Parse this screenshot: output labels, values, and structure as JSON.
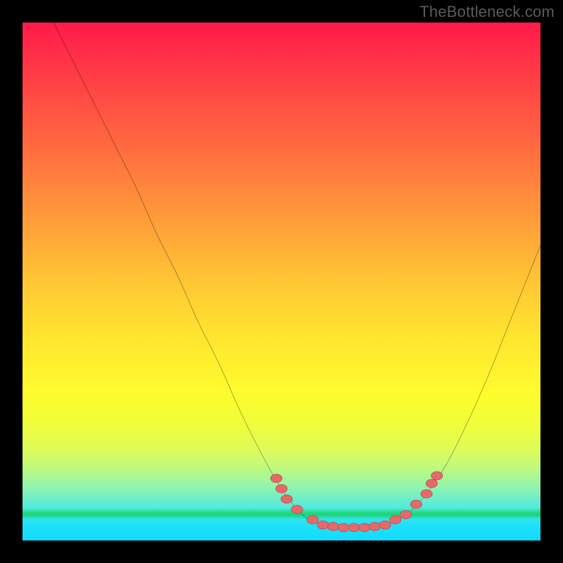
{
  "attribution": "TheBottleneck.com",
  "colors": {
    "background": "#000000",
    "attribution_text": "#5b5b5b",
    "curve_stroke": "#000000",
    "marker_fill": "#e46a6a",
    "marker_stroke": "#c74e4e",
    "gradient_top": "#ff1a4a",
    "gradient_bottom": "#10dcff",
    "green_band": "#1fd66f"
  },
  "chart_data": {
    "type": "line",
    "title": "",
    "xlabel": "",
    "ylabel": "",
    "xlim": [
      0,
      100
    ],
    "ylim": [
      0,
      100
    ],
    "grid": false,
    "legend": false,
    "curve": [
      {
        "x": 6,
        "y": 100
      },
      {
        "x": 10,
        "y": 92
      },
      {
        "x": 14,
        "y": 84
      },
      {
        "x": 18,
        "y": 76
      },
      {
        "x": 22,
        "y": 68
      },
      {
        "x": 26,
        "y": 59
      },
      {
        "x": 30,
        "y": 51
      },
      {
        "x": 34,
        "y": 42
      },
      {
        "x": 38,
        "y": 34
      },
      {
        "x": 42,
        "y": 25
      },
      {
        "x": 46,
        "y": 17
      },
      {
        "x": 50,
        "y": 10
      },
      {
        "x": 54,
        "y": 5
      },
      {
        "x": 58,
        "y": 3
      },
      {
        "x": 62,
        "y": 2.5
      },
      {
        "x": 66,
        "y": 2.5
      },
      {
        "x": 70,
        "y": 3
      },
      {
        "x": 74,
        "y": 5
      },
      {
        "x": 78,
        "y": 9
      },
      {
        "x": 82,
        "y": 15
      },
      {
        "x": 86,
        "y": 23
      },
      {
        "x": 90,
        "y": 32
      },
      {
        "x": 94,
        "y": 42
      },
      {
        "x": 98,
        "y": 52
      },
      {
        "x": 100,
        "y": 57
      }
    ],
    "markers": [
      {
        "x": 49,
        "y": 12
      },
      {
        "x": 50,
        "y": 10
      },
      {
        "x": 51,
        "y": 8
      },
      {
        "x": 53,
        "y": 6
      },
      {
        "x": 56,
        "y": 4
      },
      {
        "x": 58,
        "y": 3
      },
      {
        "x": 60,
        "y": 2.7
      },
      {
        "x": 62,
        "y": 2.5
      },
      {
        "x": 64,
        "y": 2.5
      },
      {
        "x": 66,
        "y": 2.5
      },
      {
        "x": 68,
        "y": 2.7
      },
      {
        "x": 70,
        "y": 3
      },
      {
        "x": 72,
        "y": 4
      },
      {
        "x": 74,
        "y": 5
      },
      {
        "x": 76,
        "y": 7
      },
      {
        "x": 78,
        "y": 9
      },
      {
        "x": 79,
        "y": 11
      },
      {
        "x": 80,
        "y": 12.5
      }
    ]
  }
}
